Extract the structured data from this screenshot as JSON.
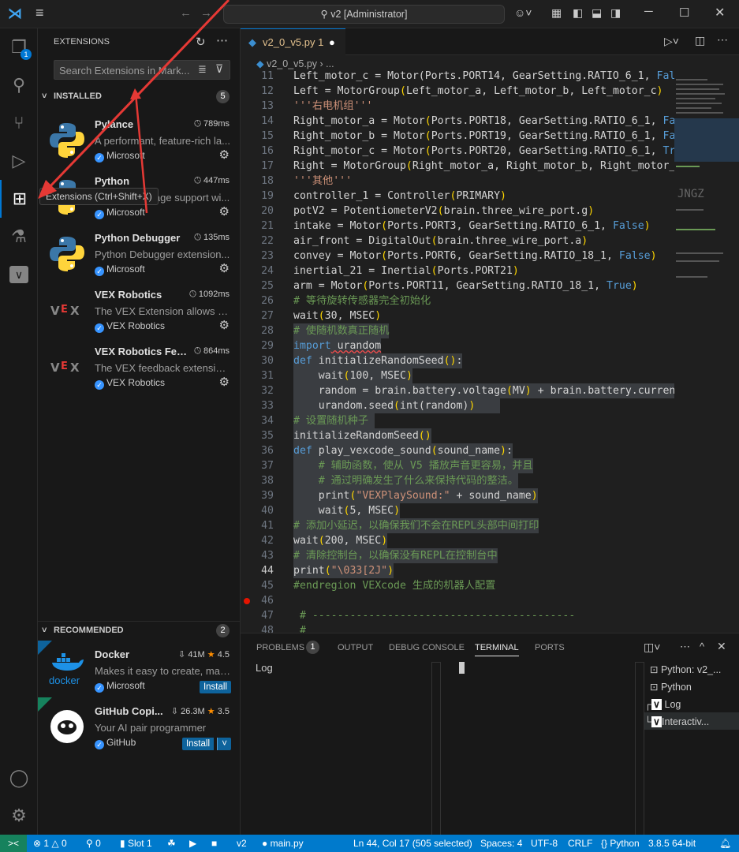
{
  "title": {
    "command_center": "v2 [Administrator]"
  },
  "activity": {
    "tooltip": "Extensions (Ctrl+Shift+X)",
    "accounts_badge": "1"
  },
  "sidebar": {
    "title": "EXTENSIONS",
    "search_placeholder": "Search Extensions in Mark...",
    "installed": {
      "label": "INSTALLED",
      "count": "5",
      "items": [
        {
          "name": "Pylance",
          "time": "789ms",
          "desc": "A performant, feature-rich la...",
          "publisher": "Microsoft"
        },
        {
          "name": "Python",
          "time": "447ms",
          "desc": "Python language support wi...",
          "publisher": "Microsoft"
        },
        {
          "name": "Python Debugger",
          "time": "135ms",
          "desc": "Python Debugger extension...",
          "publisher": "Microsoft"
        },
        {
          "name": "VEX Robotics",
          "time": "1092ms",
          "desc": "The VEX Extension allows fo...",
          "publisher": "VEX Robotics"
        },
        {
          "name": "VEX Robotics Fee...",
          "time": "864ms",
          "desc": "The VEX feedback extension...",
          "publisher": "VEX Robotics"
        }
      ]
    },
    "recommended": {
      "label": "RECOMMENDED",
      "count": "2",
      "items": [
        {
          "name": "Docker",
          "downloads": "41M",
          "rating": "4.5",
          "desc": "Makes it easy to create, man...",
          "publisher": "Microsoft",
          "install": "Install",
          "logo_text": "docker"
        },
        {
          "name": "GitHub Copi...",
          "downloads": "26.3M",
          "rating": "3.5",
          "desc": "Your AI pair programmer",
          "publisher": "GitHub",
          "install": "Install"
        }
      ]
    }
  },
  "editor": {
    "tab": {
      "label": "v2_0_v5.py",
      "problems": "1"
    },
    "breadcrumb": {
      "file": "v2_0_v5.py",
      "more": "..."
    },
    "current_line": 44,
    "breakpoint_line": 46,
    "selected_lines": [
      28,
      44
    ],
    "lines": [
      {
        "n": 11,
        "t": [
          [
            "",
            "Left_motor_c = Motor(Ports.PORT14, GearSetting.RATIO_6_1, "
          ],
          [
            "b",
            "False"
          ]
        ]
      },
      {
        "n": 12,
        "t": [
          [
            "",
            "Left = MotorGroup"
          ],
          [
            "p",
            "("
          ],
          [
            "",
            "Left_motor_a, Left_motor_b, Left_motor_c"
          ],
          [
            "p",
            ")"
          ]
        ]
      },
      {
        "n": 13,
        "t": [
          [
            "s",
            "'''右电机组'''"
          ]
        ]
      },
      {
        "n": 14,
        "t": [
          [
            "",
            "Right_motor_a = Motor"
          ],
          [
            "p",
            "("
          ],
          [
            "",
            "Ports.PORT18, GearSetting.RATIO_6_1, "
          ],
          [
            "b",
            "False"
          ]
        ]
      },
      {
        "n": 15,
        "t": [
          [
            "",
            "Right_motor_b = Motor"
          ],
          [
            "p",
            "("
          ],
          [
            "",
            "Ports.PORT19, GearSetting.RATIO_6_1, "
          ],
          [
            "b",
            "False"
          ]
        ]
      },
      {
        "n": 16,
        "t": [
          [
            "",
            "Right_motor_c = Motor"
          ],
          [
            "p",
            "("
          ],
          [
            "",
            "Ports.PORT20, GearSetting.RATIO_6_1, "
          ],
          [
            "b",
            "True"
          ]
        ]
      },
      {
        "n": 17,
        "t": [
          [
            "",
            "Right = MotorGroup"
          ],
          [
            "p",
            "("
          ],
          [
            "",
            "Right_motor_a, Right_motor_b, Right_motor_c"
          ],
          [
            "p",
            ")"
          ]
        ]
      },
      {
        "n": 18,
        "t": [
          [
            "s",
            "'''其他'''"
          ]
        ]
      },
      {
        "n": 19,
        "t": [
          [
            "",
            "controller_1 = Controller"
          ],
          [
            "p",
            "("
          ],
          [
            "",
            "PRIMARY"
          ],
          [
            "p",
            ")"
          ]
        ]
      },
      {
        "n": 20,
        "t": [
          [
            "",
            "potV2 = PotentiometerV2"
          ],
          [
            "p",
            "("
          ],
          [
            "",
            "brain.three_wire_port.g"
          ],
          [
            "p",
            ")"
          ]
        ]
      },
      {
        "n": 21,
        "t": [
          [
            "",
            "intake = Motor"
          ],
          [
            "p",
            "("
          ],
          [
            "",
            "Ports.PORT3, GearSetting.RATIO_6_1, "
          ],
          [
            "b",
            "False"
          ],
          [
            "p",
            ")"
          ]
        ]
      },
      {
        "n": 22,
        "t": [
          [
            "",
            "air_front = DigitalOut"
          ],
          [
            "p",
            "("
          ],
          [
            "",
            "brain.three_wire_port.a"
          ],
          [
            "p",
            ")"
          ]
        ]
      },
      {
        "n": 23,
        "t": [
          [
            "",
            "convey = Motor"
          ],
          [
            "p",
            "("
          ],
          [
            "",
            "Ports.PORT6, GearSetting.RATIO_18_1, "
          ],
          [
            "b",
            "False"
          ],
          [
            "p",
            ")"
          ]
        ]
      },
      {
        "n": 24,
        "t": [
          [
            "",
            "inertial_21 = Inertial"
          ],
          [
            "p",
            "("
          ],
          [
            "",
            "Ports.PORT21"
          ],
          [
            "p",
            ")"
          ]
        ]
      },
      {
        "n": 25,
        "t": [
          [
            "",
            "arm = Motor"
          ],
          [
            "p",
            "("
          ],
          [
            "",
            "Ports.PORT11, GearSetting.RATIO_18_1, "
          ],
          [
            "b",
            "True"
          ],
          [
            "p",
            ")"
          ]
        ]
      },
      {
        "n": 26,
        "t": [
          [
            "c",
            "# 等待旋转传感器完全初始化"
          ]
        ]
      },
      {
        "n": 27,
        "t": [
          [
            "",
            "wait"
          ],
          [
            "p",
            "("
          ],
          [
            "",
            "30, MSEC"
          ],
          [
            "p",
            ")"
          ]
        ]
      },
      {
        "n": 28,
        "t": [
          [
            "c",
            "# 使随机数真正随机"
          ]
        ]
      },
      {
        "n": 29,
        "t": [
          [
            "k",
            "import"
          ],
          [
            "",
            " urandom"
          ]
        ]
      },
      {
        "n": 30,
        "t": [
          [
            "k",
            "def"
          ],
          [
            "",
            " initializeRandomSeed"
          ],
          [
            "p",
            "()"
          ],
          [
            "",
            ":"
          ]
        ]
      },
      {
        "n": 31,
        "t": [
          [
            "",
            "    wait"
          ],
          [
            "p",
            "("
          ],
          [
            "",
            "100, MSEC"
          ],
          [
            "p",
            ")"
          ]
        ]
      },
      {
        "n": 32,
        "t": [
          [
            "",
            "    random = brain.battery.voltage"
          ],
          [
            "p",
            "("
          ],
          [
            "",
            "MV"
          ],
          [
            "p",
            ")"
          ],
          [
            "",
            " + brain.battery.current"
          ]
        ]
      },
      {
        "n": 33,
        "t": [
          [
            "",
            "    urandom.seed"
          ],
          [
            "p",
            "("
          ],
          [
            "",
            "int(random)"
          ],
          [
            "p",
            ")"
          ],
          [
            "",
            "    "
          ]
        ]
      },
      {
        "n": 34,
        "t": [
          [
            "c",
            "# 设置随机种子 "
          ]
        ]
      },
      {
        "n": 35,
        "t": [
          [
            "",
            "initializeRandomSeed"
          ],
          [
            "p",
            "()"
          ]
        ]
      },
      {
        "n": 36,
        "t": [
          [
            "k",
            "def"
          ],
          [
            "",
            " play_vexcode_sound"
          ],
          [
            "p",
            "("
          ],
          [
            "",
            "sound_name"
          ],
          [
            "p",
            ")"
          ],
          [
            "",
            ":"
          ]
        ]
      },
      {
        "n": 37,
        "t": [
          [
            "",
            "    "
          ],
          [
            "c",
            "# 辅助函数，使从 V5 播放声音更容易，并且"
          ]
        ]
      },
      {
        "n": 38,
        "t": [
          [
            "",
            "    "
          ],
          [
            "c",
            "# 通过明确发生了什么来保持代码的整洁。"
          ]
        ]
      },
      {
        "n": 39,
        "t": [
          [
            "",
            "    print"
          ],
          [
            "p",
            "("
          ],
          [
            "s",
            "\"VEXPlaySound:\""
          ],
          [
            "",
            " + sound_name"
          ],
          [
            "p",
            ")"
          ]
        ]
      },
      {
        "n": 40,
        "t": [
          [
            "",
            "    wait"
          ],
          [
            "p",
            "("
          ],
          [
            "",
            "5, MSEC"
          ],
          [
            "p",
            ")"
          ]
        ]
      },
      {
        "n": 41,
        "t": [
          [
            "c",
            "# 添加小延迟，以确保我们不会在REPL头部中间打印"
          ]
        ]
      },
      {
        "n": 42,
        "t": [
          [
            "",
            "wait"
          ],
          [
            "p",
            "("
          ],
          [
            "",
            "200, MSEC"
          ],
          [
            "p",
            ")"
          ]
        ]
      },
      {
        "n": 43,
        "t": [
          [
            "c",
            "# 清除控制台，以确保没有REPL在控制台中"
          ]
        ]
      },
      {
        "n": 44,
        "t": [
          [
            "",
            "print"
          ],
          [
            "p",
            "("
          ],
          [
            "s",
            "\"\\033[2J\""
          ],
          [
            "p",
            ")"
          ]
        ]
      },
      {
        "n": 45,
        "t": [
          [
            "c",
            "#endregion VEXcode 生成的机器人配置"
          ]
        ]
      },
      {
        "n": 46,
        "t": []
      },
      {
        "n": 47,
        "t": [
          [
            "c",
            " # ------------------------------------------"
          ]
        ]
      },
      {
        "n": 48,
        "t": [
          [
            "c",
            " #"
          ]
        ]
      }
    ]
  },
  "panel": {
    "tabs": [
      "PROBLEMS",
      "OUTPUT",
      "DEBUG CONSOLE",
      "TERMINAL",
      "PORTS"
    ],
    "problems_count": "1",
    "left_label": "Log",
    "terminals": [
      "Python: v2_...",
      "Python",
      "Log",
      "Interactiv..."
    ]
  },
  "status": {
    "remote": "><",
    "errors": "1",
    "warnings": "0",
    "ports": "0",
    "slot": "Slot 1",
    "project": "v2",
    "file": "main.py",
    "position": "Ln 44, Col 17 (505 selected)",
    "spaces": "Spaces: 4",
    "encoding": "UTF-8",
    "eol": "CRLF",
    "language": "Python",
    "interpreter": "3.8.5 64-bit"
  }
}
